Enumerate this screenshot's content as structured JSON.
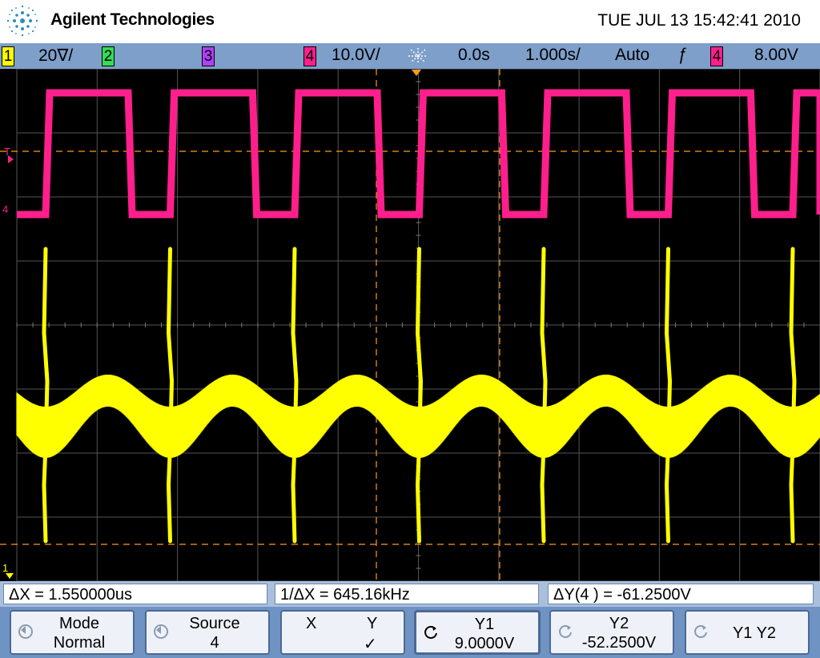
{
  "header": {
    "brand": "Agilent Technologies",
    "datetime": "TUE JUL 13 15:42:41 2010"
  },
  "status": {
    "ch1_num": "1",
    "ch1_scale": "20∇/",
    "ch2_num": "2",
    "ch3_num": "3",
    "ch4_num": "4",
    "ch4_scale": "10.0V/",
    "delay": "0.0s",
    "timebase": "1.000s/",
    "trigger_mode": "Auto",
    "trigger_slope": "ƒ",
    "trigger_source": "4",
    "trigger_level": "8.00V"
  },
  "markers": {
    "trigger_marker": "T",
    "ch4_marker": "4",
    "ch1_marker": "1"
  },
  "measurements": {
    "delta_x": "ΔX = 1.550000us",
    "inv_delta_x": "1/ΔX = 645.16kHz",
    "delta_y": "ΔY(4 ) = -61.2500V"
  },
  "softkeys": {
    "mode_label": "Mode",
    "mode_value": "Normal",
    "source_label": "Source",
    "source_value": "4",
    "x_label": "X",
    "y_label": "Y",
    "y_check": "✓",
    "y1_label": "Y1",
    "y1_value": "9.0000V",
    "y2_label": "Y2",
    "y2_value": "-52.2500V",
    "y1y2_label": "Y1 Y2"
  },
  "colors": {
    "ch1": "#ffff00",
    "ch4": "#ff1f8c",
    "ch3": "#b040ff",
    "ch2": "#33dd55",
    "statusbar": "#7d9fc9",
    "cursor": "#ff9a1a"
  }
}
